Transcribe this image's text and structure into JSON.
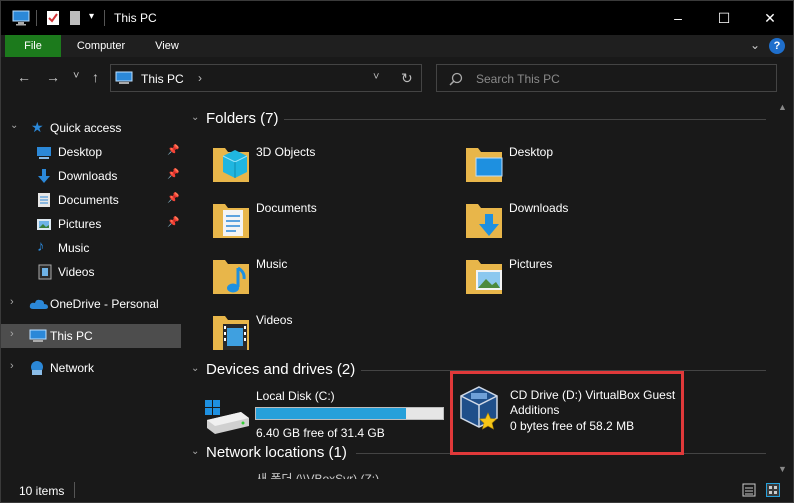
{
  "window": {
    "title": "This PC",
    "minimize": "–",
    "maximize": "☐",
    "close": "✕"
  },
  "ribbon": {
    "tabs": [
      "File",
      "Computer",
      "View"
    ],
    "expand_icon": "chevron-down-icon",
    "help": "?"
  },
  "nav": {
    "back": "←",
    "forward": "→",
    "recent": "˅",
    "up": "↑",
    "address_parts": [
      "This PC"
    ],
    "address_sep": "›",
    "dropdown": "˅",
    "refresh": "↻",
    "search_placeholder": "Search This PC"
  },
  "sidebar": {
    "quick_access": "Quick access",
    "items": [
      {
        "label": "Desktop",
        "icon": "desktop-icon",
        "pinned": true
      },
      {
        "label": "Downloads",
        "icon": "downloads-icon",
        "pinned": true
      },
      {
        "label": "Documents",
        "icon": "documents-icon",
        "pinned": true
      },
      {
        "label": "Pictures",
        "icon": "pictures-icon",
        "pinned": true
      },
      {
        "label": "Music",
        "icon": "music-icon",
        "pinned": false
      },
      {
        "label": "Videos",
        "icon": "videos-icon",
        "pinned": false
      }
    ],
    "onedrive": "OneDrive - Personal",
    "this_pc": "This PC",
    "network": "Network"
  },
  "main": {
    "folders_header": "Folders (7)",
    "folders": [
      {
        "label": "3D Objects",
        "icon": "3d-objects-folder-icon"
      },
      {
        "label": "Desktop",
        "icon": "desktop-folder-icon"
      },
      {
        "label": "Documents",
        "icon": "documents-folder-icon"
      },
      {
        "label": "Downloads",
        "icon": "downloads-folder-icon"
      },
      {
        "label": "Music",
        "icon": "music-folder-icon"
      },
      {
        "label": "Pictures",
        "icon": "pictures-folder-icon"
      },
      {
        "label": "Videos",
        "icon": "videos-folder-icon"
      }
    ],
    "devices_header": "Devices and drives (2)",
    "drives": [
      {
        "name": "Local Disk (C:)",
        "free": "6.40 GB free of 31.4 GB",
        "used_fraction": 0.8
      },
      {
        "name_line1": "CD Drive (D:) VirtualBox Guest",
        "name_line2": "Additions",
        "free": "0 bytes free of 58.2 MB"
      }
    ],
    "network_header": "Network locations (1)",
    "network_partial": "새 폴더 (\\\\VBoxSvr) (Z:)"
  },
  "status": {
    "count": "10 items"
  },
  "colors": {
    "file_tab": "#1c7a1c",
    "bar_fill": "#26a0da",
    "highlight": "#e0393a",
    "selected": "#4d4d4d"
  }
}
